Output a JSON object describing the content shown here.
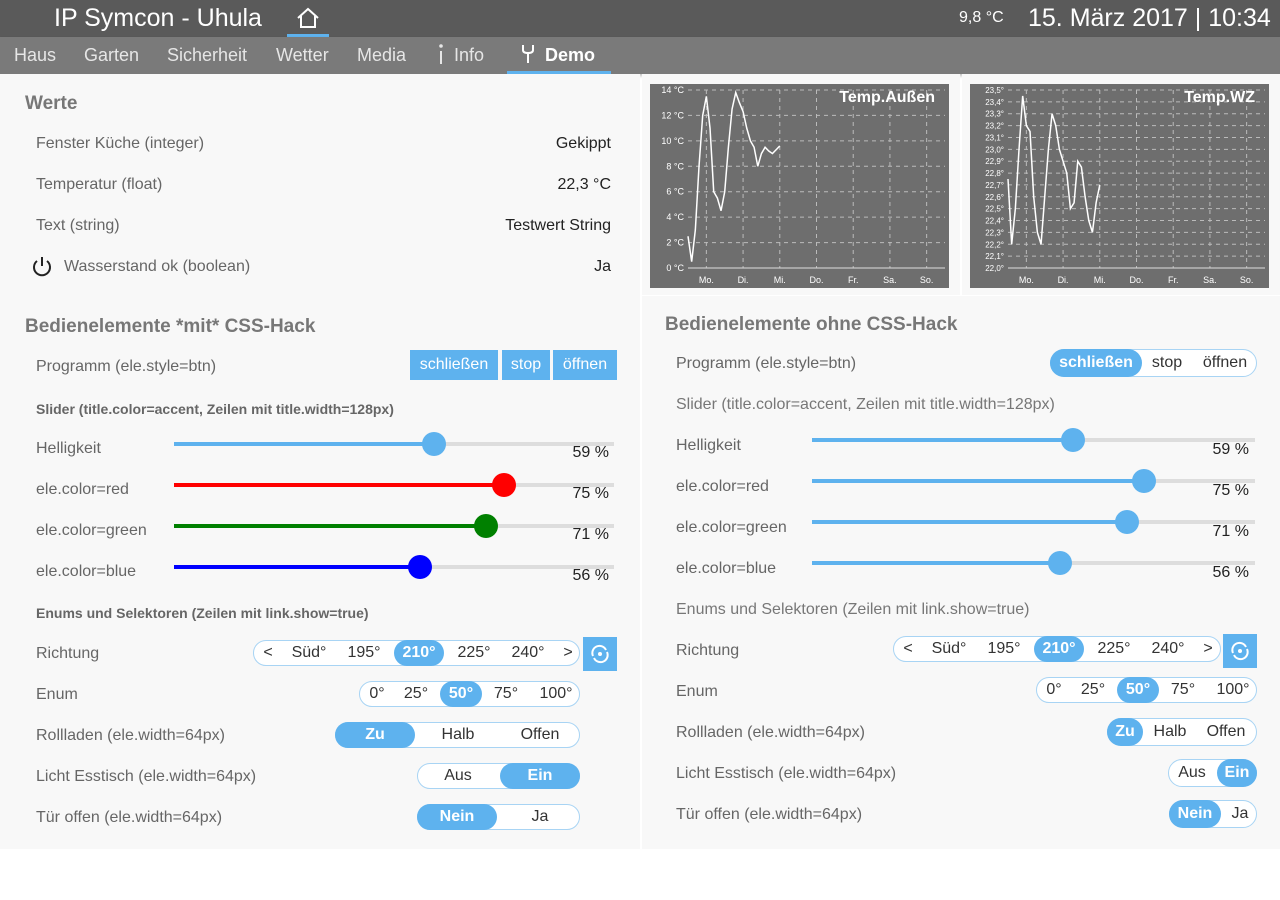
{
  "header": {
    "title": "IP Symcon - Uhula",
    "temperature": "9,8 °C",
    "datetime": "15. März 2017 | 10:34"
  },
  "nav": {
    "items": [
      "Haus",
      "Garten",
      "Sicherheit",
      "Wetter",
      "Media",
      "Info",
      "Demo"
    ],
    "active": "Demo"
  },
  "werte": {
    "title": "Werte",
    "rows": [
      {
        "label": "Fenster Küche (integer)",
        "value": "Gekippt"
      },
      {
        "label": "Temperatur (float)",
        "value": "22,3 °C"
      },
      {
        "label": "Text (string)",
        "value": "Testwert String"
      },
      {
        "label": "Wasserstand ok (boolean)",
        "value": "Ja",
        "icon": "power-icon"
      }
    ]
  },
  "left": {
    "title": "Bedienelemente *mit* CSS-Hack",
    "programm": {
      "label": "Programm (ele.style=btn)",
      "buttons": [
        "schließen",
        "stop",
        "öffnen"
      ]
    },
    "slider_title": "Slider (title.color=accent, Zeilen mit title.width=128px)",
    "sliders": [
      {
        "label": "Helligkeit",
        "value": "59 %",
        "percent": 59,
        "color": "#5eb2ee"
      },
      {
        "label": "ele.color=red",
        "value": "75 %",
        "percent": 75,
        "color": "#ff0000"
      },
      {
        "label": "ele.color=green",
        "value": "71 %",
        "percent": 71,
        "color": "#008000"
      },
      {
        "label": "ele.color=blue",
        "value": "56 %",
        "percent": 56,
        "color": "#0000ff"
      }
    ],
    "enum_title": "Enums und Selektoren (Zeilen mit link.show=true)",
    "richtung": {
      "label": "Richtung",
      "options": [
        "<",
        "Süd°",
        "195°",
        "210°",
        "225°",
        "240°",
        ">"
      ],
      "selected": "210°"
    },
    "enum": {
      "label": "Enum",
      "options": [
        "0°",
        "25°",
        "50°",
        "75°",
        "100°"
      ],
      "selected": "50°"
    },
    "rollladen": {
      "label": "Rollladen (ele.width=64px)",
      "options": [
        "Zu",
        "Halb",
        "Offen"
      ],
      "selected": "Zu"
    },
    "licht": {
      "label": "Licht Esstisch (ele.width=64px)",
      "options": [
        "Aus",
        "Ein"
      ],
      "selected": "Ein"
    },
    "tuer": {
      "label": "Tür offen (ele.width=64px)",
      "options": [
        "Nein",
        "Ja"
      ],
      "selected": "Nein"
    }
  },
  "right": {
    "title": "Bedienelemente ohne CSS-Hack",
    "programm": {
      "label": "Programm (ele.style=btn)",
      "buttons": [
        "schließen",
        "stop",
        "öffnen"
      ],
      "selected": "schließen"
    },
    "slider_title": "Slider (title.color=accent, Zeilen mit title.width=128px)",
    "sliders": [
      {
        "label": "Helligkeit",
        "value": "59 %",
        "percent": 59
      },
      {
        "label": "ele.color=red",
        "value": "75 %",
        "percent": 75
      },
      {
        "label": "ele.color=green",
        "value": "71 %",
        "percent": 71
      },
      {
        "label": "ele.color=blue",
        "value": "56 %",
        "percent": 56
      }
    ],
    "enum_title": "Enums und Selektoren (Zeilen mit link.show=true)",
    "richtung": {
      "label": "Richtung",
      "options": [
        "<",
        "Süd°",
        "195°",
        "210°",
        "225°",
        "240°",
        ">"
      ],
      "selected": "210°"
    },
    "enum": {
      "label": "Enum",
      "options": [
        "0°",
        "25°",
        "50°",
        "75°",
        "100°"
      ],
      "selected": "50°"
    },
    "rollladen": {
      "label": "Rollladen (ele.width=64px)",
      "options": [
        "Zu",
        "Halb",
        "Offen"
      ],
      "selected": "Zu"
    },
    "licht": {
      "label": "Licht Esstisch (ele.width=64px)",
      "options": [
        "Aus",
        "Ein"
      ],
      "selected": "Ein"
    },
    "tuer": {
      "label": "Tür offen (ele.width=64px)",
      "options": [
        "Nein",
        "Ja"
      ],
      "selected": "Nein"
    }
  },
  "colors": {
    "accent": "#5eb2ee",
    "chart_bg": "#6e6e6e",
    "header_bg": "#5a5a5a",
    "nav_bg": "#7a7a7a"
  },
  "chart_data": [
    {
      "type": "line",
      "title": "Temp.Außen",
      "categories": [
        "Mo.",
        "Di.",
        "Mi.",
        "Do.",
        "Fr.",
        "Sa.",
        "So."
      ],
      "yticks": [
        "0 °C",
        "2 °C",
        "4 °C",
        "6 °C",
        "8 °C",
        "10 °C",
        "12 °C",
        "14 °C"
      ],
      "ylim": [
        0,
        14
      ],
      "x": [
        0,
        0.1,
        0.2,
        0.3,
        0.4,
        0.5,
        0.6,
        0.7,
        0.8,
        0.9,
        1.0,
        1.1,
        1.2,
        1.3,
        1.4,
        1.5,
        1.6,
        1.7,
        1.8,
        1.9,
        2.0,
        2.1,
        2.2,
        2.3,
        2.4,
        2.5
      ],
      "values": [
        2.5,
        0.5,
        3.0,
        8.0,
        12.0,
        13.5,
        11.0,
        6.0,
        5.5,
        4.5,
        6.0,
        9.5,
        12.5,
        13.8,
        13.0,
        12.3,
        11.0,
        10.0,
        9.5,
        8.0,
        9.0,
        9.5,
        9.2,
        9.0,
        9.3,
        9.6
      ],
      "grid": true
    },
    {
      "type": "line",
      "title": "Temp.WZ",
      "categories": [
        "Mo.",
        "Di.",
        "Mi.",
        "Do.",
        "Fr.",
        "Sa.",
        "So."
      ],
      "yticks": [
        "22,0°",
        "22,1°",
        "22,2°",
        "22,3°",
        "22,4°",
        "22,5°",
        "22,6°",
        "22,7°",
        "22,8°",
        "22,9°",
        "23,0°",
        "23,1°",
        "23,2°",
        "23,3°",
        "23,4°",
        "23,5°"
      ],
      "ylim": [
        22.0,
        23.5
      ],
      "x": [
        0,
        0.1,
        0.2,
        0.3,
        0.4,
        0.5,
        0.6,
        0.7,
        0.8,
        0.9,
        1.0,
        1.1,
        1.2,
        1.3,
        1.4,
        1.5,
        1.6,
        1.7,
        1.8,
        1.9,
        2.0,
        2.1,
        2.2,
        2.3,
        2.4,
        2.5
      ],
      "values": [
        22.75,
        22.2,
        22.5,
        23.0,
        23.45,
        23.2,
        23.15,
        22.6,
        22.3,
        22.2,
        22.6,
        23.0,
        23.3,
        23.2,
        23.0,
        22.9,
        22.8,
        22.5,
        22.55,
        22.9,
        22.85,
        22.6,
        22.4,
        22.3,
        22.55,
        22.7
      ],
      "grid": true
    }
  ]
}
